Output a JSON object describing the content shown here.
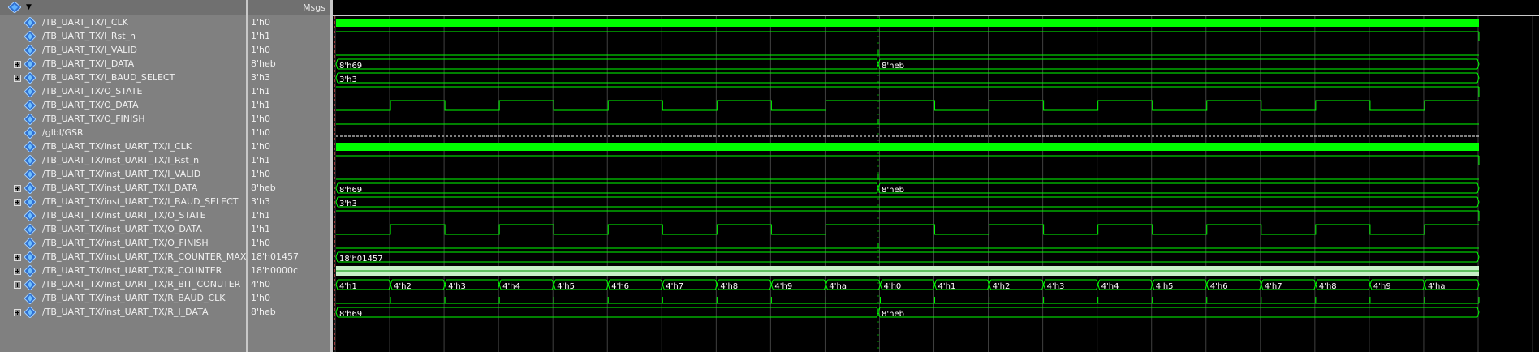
{
  "header": {
    "msgs_label": "Msgs",
    "toolbar_icon": "diamond-signal-icon"
  },
  "colors": {
    "wave": "#00ff00",
    "bus_text": "#ffffff",
    "grid": "#404040",
    "cursor": "#ff4040",
    "pane_bg": "#808080"
  },
  "signals": [
    {
      "name": "/TB_UART_TX/I_CLK",
      "value": "1'h0",
      "bus": false,
      "kind": "clk"
    },
    {
      "name": "/TB_UART_TX/I_Rst_n",
      "value": "1'h1",
      "bus": false,
      "kind": "high"
    },
    {
      "name": "/TB_UART_TX/I_VALID",
      "value": "1'h0",
      "bus": false,
      "kind": "low"
    },
    {
      "name": "/TB_UART_TX/I_DATA",
      "value": "8'heb",
      "bus": true,
      "kind": "bus",
      "segments": [
        "8'h69",
        "8'heb"
      ]
    },
    {
      "name": "/TB_UART_TX/I_BAUD_SELECT",
      "value": "3'h3",
      "bus": true,
      "kind": "bus",
      "segments": [
        "3'h3"
      ]
    },
    {
      "name": "/TB_UART_TX/O_STATE",
      "value": "1'h1",
      "bus": false,
      "kind": "high"
    },
    {
      "name": "/TB_UART_TX/O_DATA",
      "value": "1'h1",
      "bus": false,
      "kind": "serial"
    },
    {
      "name": "/TB_UART_TX/O_FINISH",
      "value": "1'h0",
      "bus": false,
      "kind": "low"
    },
    {
      "name": "/glbl/GSR",
      "value": "1'h0",
      "bus": false,
      "kind": "dashed"
    },
    {
      "name": "/TB_UART_TX/inst_UART_TX/I_CLK",
      "value": "1'h0",
      "bus": false,
      "kind": "clk"
    },
    {
      "name": "/TB_UART_TX/inst_UART_TX/I_Rst_n",
      "value": "1'h1",
      "bus": false,
      "kind": "high"
    },
    {
      "name": "/TB_UART_TX/inst_UART_TX/I_VALID",
      "value": "1'h0",
      "bus": false,
      "kind": "low"
    },
    {
      "name": "/TB_UART_TX/inst_UART_TX/I_DATA",
      "value": "8'heb",
      "bus": true,
      "kind": "bus",
      "segments": [
        "8'h69",
        "8'heb"
      ]
    },
    {
      "name": "/TB_UART_TX/inst_UART_TX/I_BAUD_SELECT",
      "value": "3'h3",
      "bus": true,
      "kind": "bus",
      "segments": [
        "3'h3"
      ]
    },
    {
      "name": "/TB_UART_TX/inst_UART_TX/O_STATE",
      "value": "1'h1",
      "bus": false,
      "kind": "high"
    },
    {
      "name": "/TB_UART_TX/inst_UART_TX/O_DATA",
      "value": "1'h1",
      "bus": false,
      "kind": "serial"
    },
    {
      "name": "/TB_UART_TX/inst_UART_TX/O_FINISH",
      "value": "1'h0",
      "bus": false,
      "kind": "low"
    },
    {
      "name": "/TB_UART_TX/inst_UART_TX/R_COUNTER_MAX",
      "value": "18'h01457",
      "bus": true,
      "kind": "bus",
      "segments": [
        "18'h01457"
      ]
    },
    {
      "name": "/TB_UART_TX/inst_UART_TX/R_COUNTER",
      "value": "18'h0000c",
      "bus": true,
      "kind": "fastbus"
    },
    {
      "name": "/TB_UART_TX/inst_UART_TX/R_BIT_CONUTER",
      "value": "4'h0",
      "bus": true,
      "kind": "bus",
      "segments": [
        "4'h1",
        "4'h2",
        "4'h3",
        "4'h4",
        "4'h5",
        "4'h6",
        "4'h7",
        "4'h8",
        "4'h9",
        "4'ha",
        "4'h0",
        "4'h1",
        "4'h2",
        "4'h3",
        "4'h4",
        "4'h5",
        "4'h6",
        "4'h7",
        "4'h8",
        "4'h9",
        "4'ha"
      ]
    },
    {
      "name": "/TB_UART_TX/inst_UART_TX/R_BAUD_CLK",
      "value": "1'h0",
      "bus": false,
      "kind": "pulses"
    },
    {
      "name": "/TB_UART_TX/inst_UART_TX/R_I_DATA",
      "value": "8'heb",
      "bus": true,
      "kind": "bus",
      "segments": [
        "8'h69",
        "8'heb"
      ]
    }
  ]
}
